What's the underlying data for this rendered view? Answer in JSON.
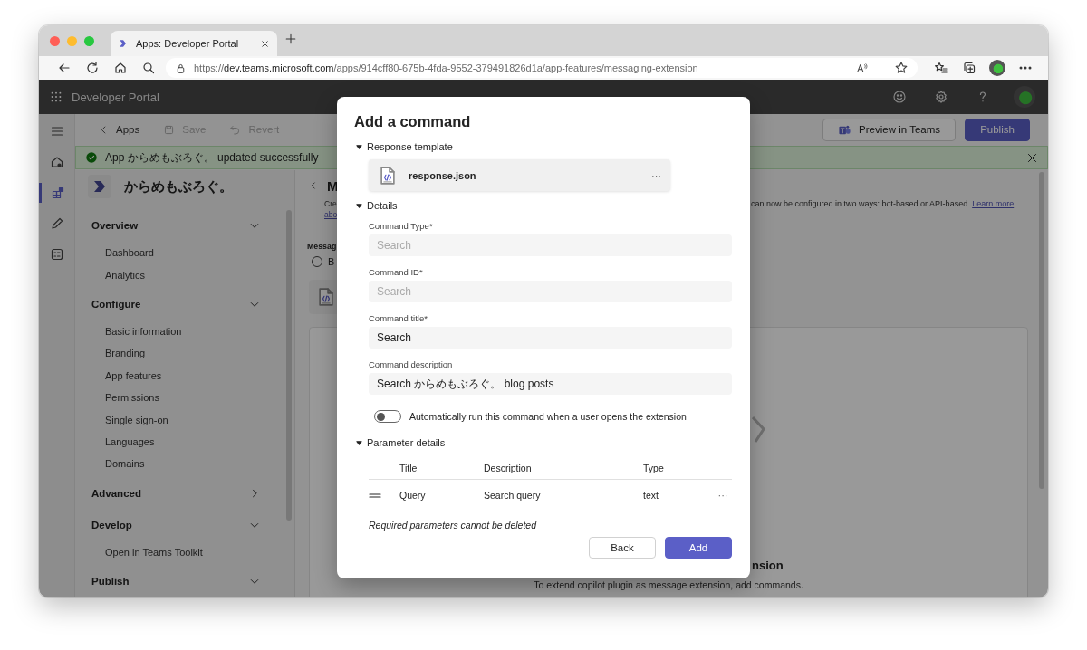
{
  "browser": {
    "tabs": [
      {
        "title": "Apps: Developer Portal",
        "selected": true
      }
    ],
    "url": "https://**dev.teams.microsoft.com**/apps/914cff80-675b-4fda-9552-379491826d1a/app-features/messaging-extension"
  },
  "app_bar": {
    "title": "Developer Portal"
  },
  "rail": [
    {
      "kind": "home",
      "selected": false
    },
    {
      "kind": "apps",
      "selected": true
    },
    {
      "kind": "edit",
      "selected": false
    },
    {
      "kind": "checklist",
      "selected": false
    }
  ],
  "toolbar": {
    "back": "Apps",
    "actions": [
      {
        "kind": "save",
        "label": "Save",
        "disabled": true
      },
      {
        "kind": "revert",
        "label": "Revert",
        "disabled": true
      }
    ],
    "buttons": [
      {
        "kind": "secondary",
        "label": "Preview in Teams"
      },
      {
        "kind": "primary",
        "label": "Publish"
      }
    ]
  },
  "banner": {
    "message": "App からめもぶろぐ。 updated successfully"
  },
  "nav": {
    "app_name": "からめもぶろぐ。",
    "groups": [
      {
        "label": "Overview",
        "expanded": true,
        "children": [
          {
            "label": "Dashboard"
          },
          {
            "label": "Analytics"
          }
        ]
      },
      {
        "label": "Configure",
        "expanded": true,
        "children": [
          {
            "label": "Basic information"
          },
          {
            "label": "Branding"
          },
          {
            "label": "App features"
          },
          {
            "label": "Permissions"
          },
          {
            "label": "Single sign-on"
          },
          {
            "label": "Languages"
          },
          {
            "label": "Domains"
          }
        ]
      },
      {
        "label": "Advanced",
        "expanded": false
      },
      {
        "label": "Develop",
        "expanded": true,
        "children": [
          {
            "label": "Open in Teams Toolkit"
          }
        ]
      },
      {
        "label": "Publish",
        "expanded": true
      }
    ]
  },
  "content": {
    "heading": "M",
    "description_left": [
      "Cre",
      "abo"
    ],
    "description_right": "can now be configured in two ways: bot-based or API-based.",
    "link": "Learn more",
    "section_label": "Messag",
    "radio": {
      "label": "B",
      "checked": false
    },
    "empty_state": {
      "title": "nsion",
      "text": "To extend copilot plugin as message extension, add commands."
    }
  },
  "dialog": {
    "title": "Add a command",
    "response_section": {
      "label": "Response template",
      "expanded": true,
      "file": "response.json",
      "more": "···"
    },
    "details_section": {
      "label": "Details",
      "expanded": true,
      "fields": [
        {
          "label": "Command Type*",
          "placeholder": "Search"
        },
        {
          "label": "Command ID*",
          "placeholder": "Search"
        },
        {
          "label": "Command title*",
          "value": "Search"
        },
        {
          "label": "Command description",
          "value": "Search からめもぶろぐ。 blog posts"
        }
      ],
      "toggle": {
        "label": "Automatically run this command when a user opens the extension",
        "on": false
      }
    },
    "parameter_section": {
      "label": "Parameter details",
      "expanded": true,
      "columns": [
        "Title",
        "Description",
        "Type"
      ],
      "rows": [
        {
          "title": "Query",
          "description": "Search query",
          "type": "text",
          "more": "···"
        }
      ]
    },
    "note": "Required parameters cannot be deleted",
    "buttons": [
      {
        "kind": "secondary",
        "label": "Back"
      },
      {
        "kind": "primary",
        "label": "Add"
      }
    ]
  }
}
